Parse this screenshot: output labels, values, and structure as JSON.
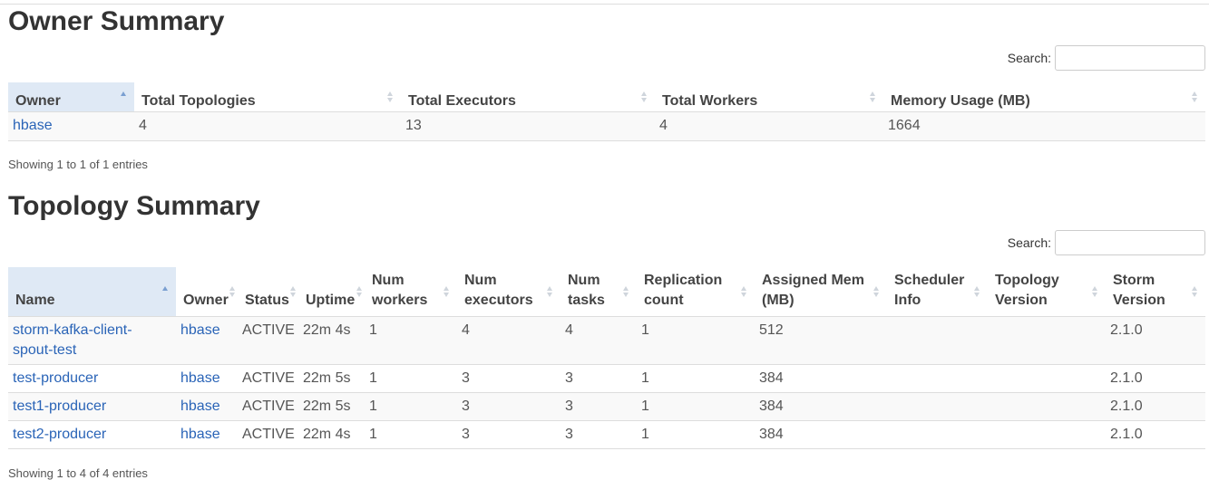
{
  "owner_summary": {
    "title": "Owner Summary",
    "search_label": "Search:",
    "columns": [
      "Owner",
      "Total Topologies",
      "Total Executors",
      "Total Workers",
      "Memory Usage (MB)"
    ],
    "rows": [
      {
        "owner": "hbase",
        "total_topologies": "4",
        "total_executors": "13",
        "total_workers": "4",
        "memory_usage": "1664"
      }
    ],
    "info": "Showing 1 to 1 of 1 entries"
  },
  "topology_summary": {
    "title": "Topology Summary",
    "search_label": "Search:",
    "columns": {
      "name": "Name",
      "owner": "Owner",
      "status": "Status",
      "uptime": "Uptime",
      "num_workers": [
        "Num",
        "workers"
      ],
      "num_executors": [
        "Num",
        "executors"
      ],
      "num_tasks": [
        "Num",
        "tasks"
      ],
      "replication_count": [
        "Replication",
        "count"
      ],
      "assigned_mem": [
        "Assigned Mem",
        "(MB)"
      ],
      "scheduler_info": [
        "Scheduler",
        "Info"
      ],
      "topology_version": [
        "Topology",
        "Version"
      ],
      "storm_version": [
        "Storm",
        "Version"
      ]
    },
    "rows": [
      {
        "name": "storm-kafka-client-spout-test",
        "owner": "hbase",
        "status": "ACTIVE",
        "uptime": "22m 4s",
        "num_workers": "1",
        "num_executors": "4",
        "num_tasks": "4",
        "replication_count": "1",
        "assigned_mem": "512",
        "scheduler_info": "",
        "topology_version": "",
        "storm_version": "2.1.0"
      },
      {
        "name": "test-producer",
        "owner": "hbase",
        "status": "ACTIVE",
        "uptime": "22m 5s",
        "num_workers": "1",
        "num_executors": "3",
        "num_tasks": "3",
        "replication_count": "1",
        "assigned_mem": "384",
        "scheduler_info": "",
        "topology_version": "",
        "storm_version": "2.1.0"
      },
      {
        "name": "test1-producer",
        "owner": "hbase",
        "status": "ACTIVE",
        "uptime": "22m 5s",
        "num_workers": "1",
        "num_executors": "3",
        "num_tasks": "3",
        "replication_count": "1",
        "assigned_mem": "384",
        "scheduler_info": "",
        "topology_version": "",
        "storm_version": "2.1.0"
      },
      {
        "name": "test2-producer",
        "owner": "hbase",
        "status": "ACTIVE",
        "uptime": "22m 4s",
        "num_workers": "1",
        "num_executors": "3",
        "num_tasks": "3",
        "replication_count": "1",
        "assigned_mem": "384",
        "scheduler_info": "",
        "topology_version": "",
        "storm_version": "2.1.0"
      }
    ],
    "info": "Showing 1 to 4 of 4 entries"
  },
  "colors": {
    "link": "#2a64b7",
    "sorted_header_bg": "#dfe9f5",
    "border": "#dddddd"
  }
}
